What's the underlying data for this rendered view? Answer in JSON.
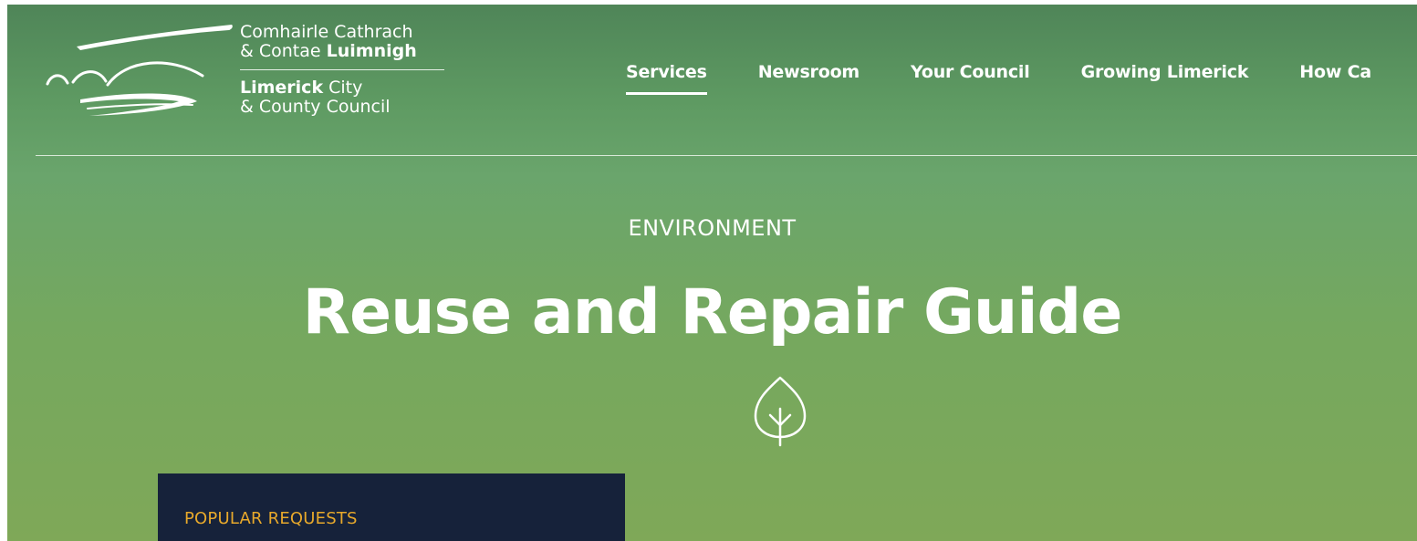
{
  "logo": {
    "line1": "Comhairle Cathrach",
    "line2_prefix": "& Contae ",
    "line2_bold": "Luimnigh",
    "line3_bold": "Limerick",
    "line3_suffix": " City",
    "line4": "& County Council",
    "icon": "limerick-bridge-logo"
  },
  "nav": {
    "items": [
      {
        "label": "Services",
        "active": true
      },
      {
        "label": "Newsroom",
        "active": false
      },
      {
        "label": "Your Council",
        "active": false
      },
      {
        "label": "Growing Limerick",
        "active": false
      },
      {
        "label": "How Ca",
        "active": false
      }
    ]
  },
  "hero": {
    "eyebrow": "ENVIRONMENT",
    "title": "Reuse and Repair Guide",
    "icon": "leaf-icon"
  },
  "popular": {
    "title": "POPULAR REQUESTS"
  },
  "colors": {
    "header_green": "#4f8558",
    "hero_green": "#6aa56c",
    "bottom_green": "#7fa858",
    "panel_navy": "#16223a",
    "accent_orange": "#e8a92b",
    "text_white": "#ffffff"
  }
}
